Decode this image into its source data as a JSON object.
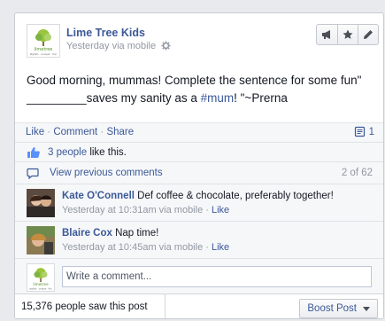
{
  "post": {
    "page_name": "Lime Tree Kids",
    "logo_caption": "stylish · unique · fun",
    "timestamp": "Yesterday via mobile",
    "text_main": "Good morning, mummas! Complete the sentence for some fun\" _________saves my sanity as a ",
    "hashtag": "#mum",
    "text_tail": "! \"~Prerna"
  },
  "actions": {
    "like": "Like",
    "comment": "Comment",
    "share": "Share",
    "separator": " · ",
    "comment_count": "1"
  },
  "likes": {
    "people": "3 people",
    "suffix": " like this."
  },
  "previous_comments": {
    "label": "View previous comments",
    "position": "2 of 62"
  },
  "comments": [
    {
      "author": "Kate O'Connell",
      "text": " Def coffee & chocolate, preferably together!",
      "meta": "Yesterday at 10:31am via mobile · ",
      "like": "Like"
    },
    {
      "author": "Blaire Cox",
      "text": " Nap time!",
      "meta": "Yesterday at 10:45am via mobile · ",
      "like": "Like"
    }
  ],
  "composer": {
    "placeholder": "Write a comment..."
  },
  "footer": {
    "reach": "15,376 people saw this post",
    "boost_label": "Boost Post"
  },
  "colors": {
    "link": "#3b5998",
    "meta": "#9197a3",
    "ufi_background": "#f6f7f9"
  },
  "icons": {
    "toolbar": [
      "megaphone-icon",
      "star-icon",
      "pencil-icon"
    ],
    "gear": "gear-icon",
    "thumbs_up": "thumbs-up-icon",
    "speech_bubble": "speech-bubble-icon",
    "comment_count": "comment-count-icon",
    "dropdown": "chevron-down-icon"
  }
}
